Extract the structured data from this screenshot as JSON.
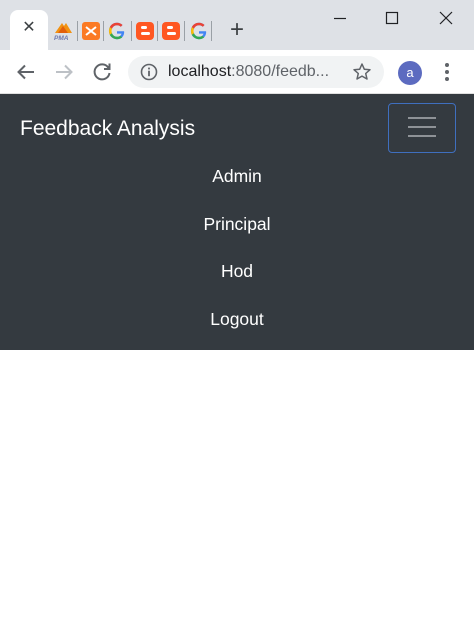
{
  "browser": {
    "tab_close_glyph": "✕",
    "new_tab_glyph": "+",
    "avatar_letter": "a",
    "url_host": "localhost",
    "url_rest": ":8080/feedb..."
  },
  "navbar": {
    "brand": "Feedback Analysis",
    "links": [
      {
        "label": "Admin"
      },
      {
        "label": "Principal"
      },
      {
        "label": "Hod"
      },
      {
        "label": "Logout"
      }
    ]
  },
  "colors": {
    "navbar_bg": "#343a40",
    "toggler_border": "#3f6fbf",
    "tabstrip_bg": "#dee1e6",
    "avatar_bg": "#5c6bc0"
  },
  "icons": [
    "close-icon",
    "phpmyadmin-favicon",
    "xampp-favicon",
    "google-favicon",
    "blogger-favicon",
    "new-tab-icon",
    "minimize-icon",
    "maximize-icon",
    "window-close-icon",
    "back-arrow-icon",
    "forward-arrow-icon",
    "reload-icon",
    "info-icon",
    "star-icon",
    "kebab-menu-icon",
    "hamburger-icon"
  ]
}
